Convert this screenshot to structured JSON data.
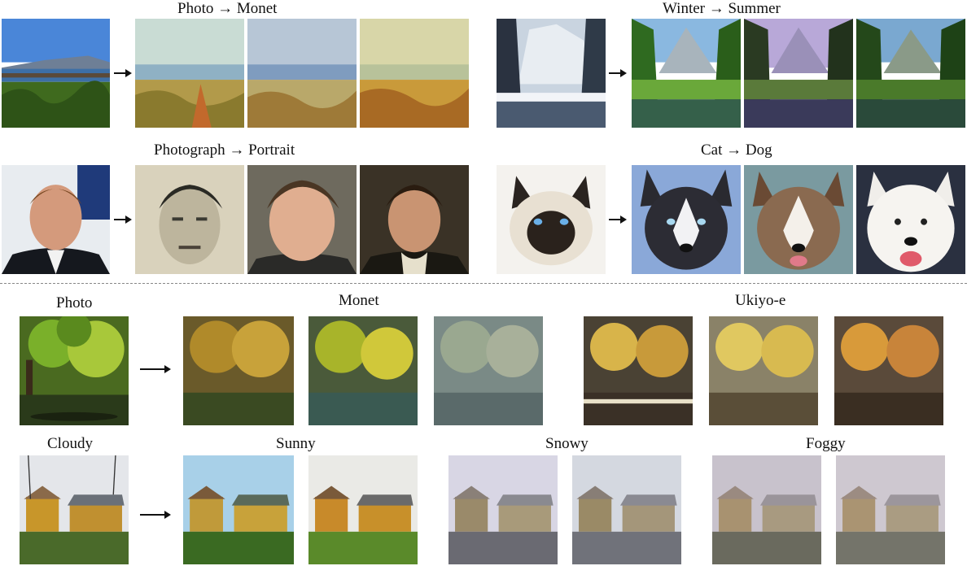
{
  "top_left": {
    "row1_label": "Photo → Monet",
    "row2_label": "Photograph → Portrait"
  },
  "top_right": {
    "row1_label": "Winter → Summer",
    "row2_label": "Cat → Dog"
  },
  "bottom": {
    "row1_labels": {
      "source": "Photo",
      "target1": "Monet",
      "target2": "Ukiyo-e"
    },
    "row2_labels": {
      "source": "Cloudy",
      "target1": "Sunny",
      "target2": "Snowy",
      "target3": "Foggy"
    }
  }
}
